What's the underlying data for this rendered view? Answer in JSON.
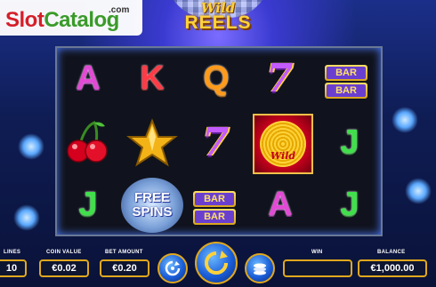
{
  "watermark": {
    "slot": "Slot",
    "catalog": "Catalog",
    "com": ".com"
  },
  "game_title": {
    "wild": "Wild",
    "reels": "REELS"
  },
  "reels": {
    "row1": [
      "A",
      "K",
      "Q",
      "7",
      "BAR"
    ],
    "row2": [
      "cherry-icon",
      "star-icon",
      "7",
      "Wild",
      "J"
    ],
    "row3": [
      "J",
      "FREE SPINS",
      "BAR",
      "A",
      "J"
    ]
  },
  "symbols": {
    "A": "A",
    "K": "K",
    "Q": "Q",
    "J": "J",
    "seven": "7",
    "bar": "BAR",
    "wild": "Wild",
    "free_line1": "FREE",
    "free_line2": "SPINS"
  },
  "controls": {
    "lines_label": "LINES",
    "lines_value": "10",
    "coin_value_label": "COIN VALUE",
    "coin_value": "€0.02",
    "bet_amount_label": "BET AMOUNT",
    "bet_amount": "€0.20",
    "win_label": "WIN",
    "win_value": "",
    "balance_label": "BALANCE",
    "balance_value": "€1,000.00"
  },
  "colors": {
    "accent_gold": "#e0a81e",
    "spin_blue": "#1b5ed8",
    "frame_bg": "#10131d"
  },
  "icons": {
    "autoplay": "autoplay-icon",
    "spin": "spin-icon",
    "coins": "coins-icon"
  }
}
